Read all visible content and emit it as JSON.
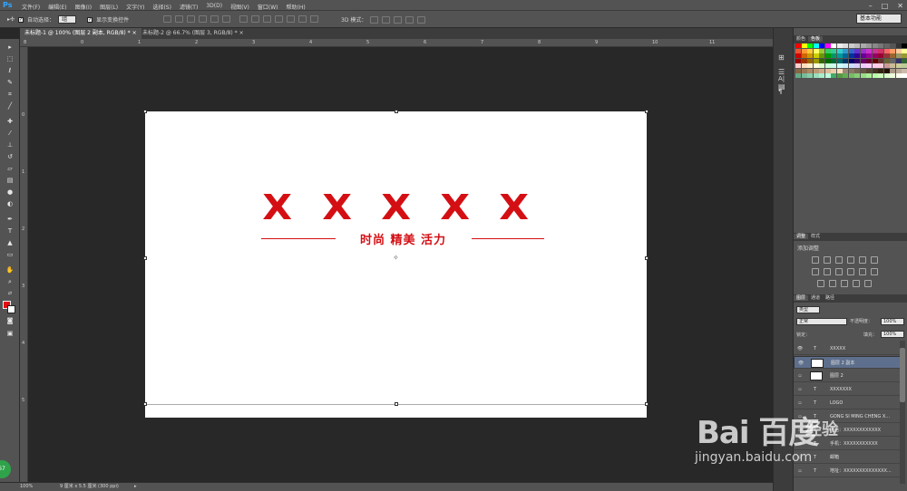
{
  "app": {
    "logo": "Ps"
  },
  "menu": [
    "文件(F)",
    "编辑(E)",
    "图像(I)",
    "图层(L)",
    "文字(Y)",
    "选择(S)",
    "滤镜(T)",
    "3D(D)",
    "视图(V)",
    "窗口(W)",
    "帮助(H)"
  ],
  "window_controls": [
    "–",
    "□",
    "✕"
  ],
  "options_bar": {
    "auto_select_label": "自动选择：",
    "auto_select_value": "组",
    "show_transform_label": "显示变换控件",
    "mode_3d_label": "3D 模式：",
    "workspace": "基本功能"
  },
  "tabs": [
    {
      "label": "未标题-1 @ 100% (图层 2 副本, RGB/8) *",
      "close": "×"
    },
    {
      "label": "未标题-2 @ 66.7% (图层 3, RGB/8) *",
      "close": "×"
    }
  ],
  "ruler_top": [
    "8",
    "0",
    "1",
    "2",
    "3",
    "4",
    "5",
    "6",
    "7",
    "8",
    "9",
    "10",
    "11"
  ],
  "ruler_left": [
    "0",
    "1",
    "2",
    "3",
    "4",
    "5"
  ],
  "document": {
    "marks": [
      "X",
      "X",
      "X",
      "X",
      "X"
    ],
    "tagline": "时尚 精美 活力",
    "accent_color": "#d40f14"
  },
  "status": {
    "zoom": "100%",
    "info": "9 厘米 x 5.5 厘米 (300 ppi)"
  },
  "panels": {
    "swatches_tabs": [
      "颜色",
      "色板"
    ],
    "adjust_tabs": [
      "调整",
      "样式"
    ],
    "adjust_title": "添加调整",
    "layers_tabs": [
      "图层",
      "通道",
      "路径"
    ],
    "kind_filter": "类型",
    "blend_mode": "正常",
    "opacity_label": "不透明度：",
    "opacity_value": "100%",
    "lock_label": "锁定：",
    "fill_label": "填充：",
    "fill_value": "100%",
    "layers": [
      {
        "name": "XXXXX",
        "kind": "T",
        "visible": true
      },
      {
        "name": "图层 2 副本",
        "kind": "img",
        "visible": true,
        "selected": true
      },
      {
        "name": "图层 2",
        "kind": "img",
        "visible": false
      },
      {
        "name": "XXXXXXX",
        "kind": "T",
        "visible": false
      },
      {
        "name": "LOGO",
        "kind": "T",
        "visible": false
      },
      {
        "name": "GONG SI MING CHENG X...",
        "kind": "T",
        "visible": false
      },
      {
        "name": "电话：XXXXXXXXXXXX",
        "kind": "T",
        "visible": false
      },
      {
        "name": "手机：XXXXXXXXXXX",
        "kind": "T",
        "visible": false
      },
      {
        "name": "邮箱",
        "kind": "T",
        "visible": false
      },
      {
        "name": "地址：XXXXXXXXXXXXXX...",
        "kind": "T",
        "visible": false
      }
    ]
  },
  "watermark": {
    "logo": "Bai  百度",
    "jingyan": "经验",
    "url": "jingyan.baidu.com"
  },
  "badge": "67"
}
